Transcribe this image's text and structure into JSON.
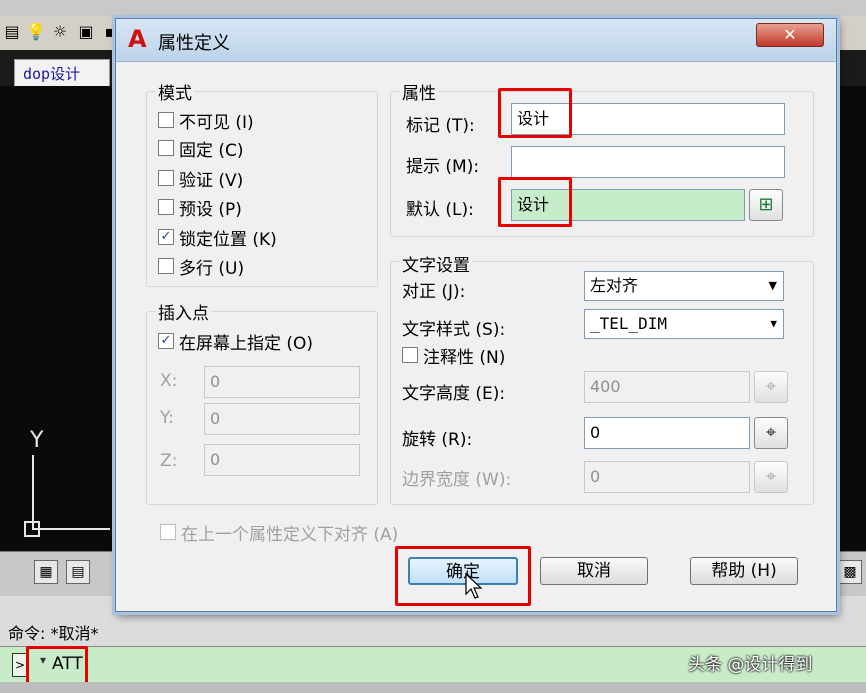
{
  "app": {
    "doc_tab": "dop设计",
    "ucs_y": "Y",
    "command_history": "命令: *取消*",
    "command_input": "ATT",
    "watermark": "头条 @设计得到"
  },
  "dialog": {
    "title": "属性定义",
    "close": "✕",
    "mode": {
      "label": "模式",
      "options": [
        {
          "label": "不可见 (I)",
          "checked": false
        },
        {
          "label": "固定 (C)",
          "checked": false
        },
        {
          "label": "验证 (V)",
          "checked": false
        },
        {
          "label": "预设 (P)",
          "checked": false
        },
        {
          "label": "锁定位置 (K)",
          "checked": true
        },
        {
          "label": "多行 (U)",
          "checked": false
        }
      ]
    },
    "insert": {
      "label": "插入点",
      "on_screen": "在屏幕上指定 (O)",
      "x_label": "X:",
      "x_value": "0",
      "y_label": "Y:",
      "y_value": "0",
      "z_label": "Z:",
      "z_value": "0"
    },
    "attribute": {
      "label": "属性",
      "tag_label": "标记 (T):",
      "tag_value": "设计",
      "prompt_label": "提示 (M):",
      "prompt_value": "",
      "default_label": "默认 (L):",
      "default_value": "设计"
    },
    "text": {
      "label": "文字设置",
      "justify_label": "对正 (J):",
      "justify_value": "左对齐",
      "style_label": "文字样式 (S):",
      "style_value": "_TEL_DIM",
      "annotative_label": "注释性 (N)",
      "height_label": "文字高度 (E):",
      "height_value": "400",
      "rotation_label": "旋转 (R):",
      "rotation_value": "0",
      "width_label": "边界宽度 (W):",
      "width_value": "0"
    },
    "align_prev": "在上一个属性定义下对齐 (A)",
    "buttons": {
      "ok": "确定",
      "cancel": "取消",
      "help": "帮助 (H)"
    }
  },
  "colors": {
    "highlight": "#e60000",
    "command_bg": "#c8ecc8",
    "default_field_bg": "#c6ecca"
  }
}
